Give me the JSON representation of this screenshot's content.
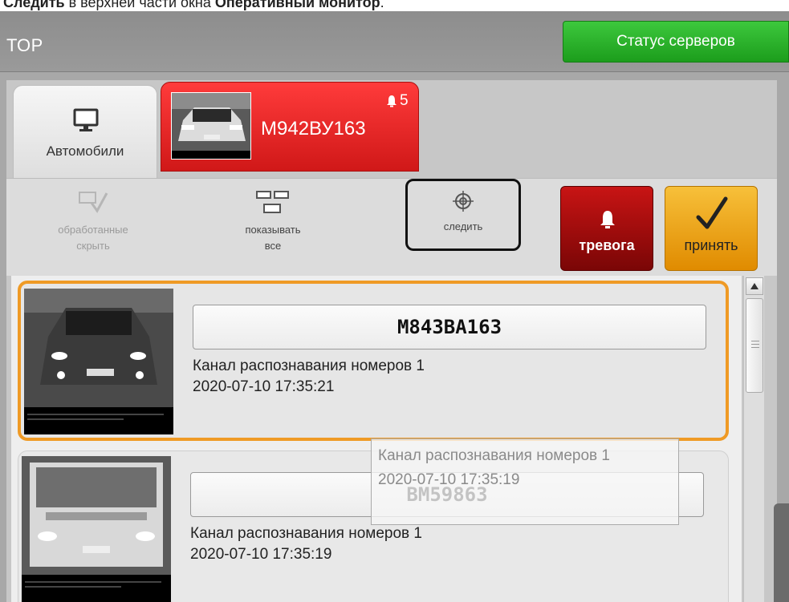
{
  "caption": {
    "b1": "Следить",
    "mid": " в верхней части окна ",
    "b2": "Оперативный монитор",
    "end": "."
  },
  "topbar": {
    "title": "ТОР",
    "status_button": "Статус серверов"
  },
  "tabs": [
    {
      "label": "Автомобили",
      "icon": "monitor-icon"
    },
    {
      "plate": "М942ВУ163",
      "alarm_count": "5",
      "icon": "bell-icon"
    }
  ],
  "toolbar": {
    "hide_processed": "обработанные\nскрыть",
    "show_all": "показывать\nвсе",
    "follow": "следить",
    "alarm": "тревога",
    "accept": "принять"
  },
  "events": [
    {
      "plate": "М843ВА163",
      "channel": "Канал распознавания номеров 1",
      "timestamp": "2020-07-10 17:35:21"
    },
    {
      "plate": "ВМ59863",
      "channel": "Канал распознавания номеров 1",
      "timestamp": "2020-07-10 17:35:19"
    }
  ],
  "tooltip": {
    "channel": "Канал распознавания номеров 1",
    "timestamp": "2020-07-10 17:35:19"
  },
  "colors": {
    "status_green": "#1c9d1c",
    "alarm_red": "#c81414",
    "accept_orange": "#e08b00",
    "selection_orange": "#ef9a25"
  }
}
